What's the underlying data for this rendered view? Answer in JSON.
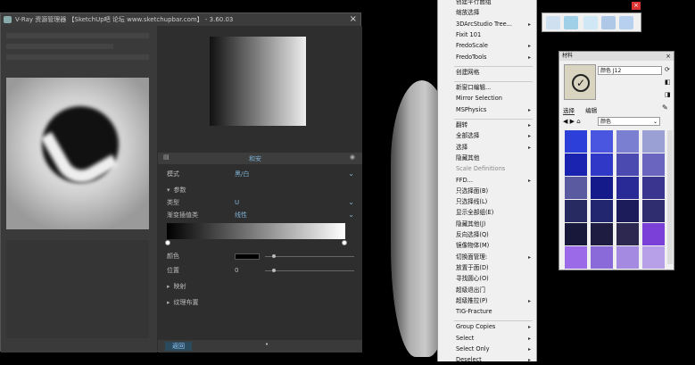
{
  "vray": {
    "title": "V-Ray 资源管理器 【SketchUp吧 论坛 www.sketchupbar.com】 - 3.60.03",
    "close": "×",
    "texture_header": "和安",
    "rows": {
      "mode_label": "模式",
      "mode_value": "黑/白",
      "params_label": "参数",
      "type_label": "类型",
      "type_value": "U",
      "interp_label": "渐变插值类",
      "interp_value": "线性",
      "color_label": "颜色",
      "pos_label": "位置",
      "pos_value": "0",
      "blend_label": "映射",
      "tex_label": "纹理布置"
    },
    "footer_tab": "返回"
  },
  "menu": {
    "items": [
      {
        "label": "创建平行面组",
        "sub": false
      },
      {
        "label": "缩放选择",
        "sub": false
      },
      {
        "label": "3DArcStudio Tree...",
        "sub": true
      },
      {
        "label": "Fixit 101",
        "sub": false
      },
      {
        "label": "FredoScale",
        "sub": true
      },
      {
        "label": "FredoTools",
        "sub": true
      },
      {
        "label": "创建网格",
        "sub": false
      },
      {
        "label": "新窗口编辑...",
        "sub": false
      },
      {
        "label": "Mirror Selection",
        "sub": false
      },
      {
        "label": "MSPhysics",
        "sub": true
      },
      {
        "label": "翻转",
        "sub": true
      },
      {
        "label": "全部选择",
        "sub": true
      },
      {
        "label": "选择",
        "sub": true
      },
      {
        "label": "隐藏其他",
        "sub": false
      },
      {
        "label": "Scale Definitions",
        "sub": false,
        "disabled": true
      },
      {
        "label": "FFD...",
        "sub": true
      },
      {
        "label": "只选择面(B)",
        "sub": false
      },
      {
        "label": "只选择线(L)",
        "sub": false
      },
      {
        "label": "显示全部组(E)",
        "sub": false
      },
      {
        "label": "隐藏其他(J)",
        "sub": false
      },
      {
        "label": "反向选择(Q)",
        "sub": false
      },
      {
        "label": "镜像物体(M)",
        "sub": false
      },
      {
        "label": "切换面管理:",
        "sub": true
      },
      {
        "label": "放置于面(D)",
        "sub": false
      },
      {
        "label": "寻找圆心(O)",
        "sub": false
      },
      {
        "label": "超级退出门",
        "sub": false
      },
      {
        "label": "超级推拉(P)",
        "sub": true
      },
      {
        "label": "TIG-Fracture",
        "sub": false
      },
      {
        "label": "Group Copies",
        "sub": true
      },
      {
        "label": "Select",
        "sub": true
      },
      {
        "label": "Select Only",
        "sub": true
      },
      {
        "label": "Deselect",
        "sub": true
      }
    ],
    "sub_arrow": "▸"
  },
  "toolbar": {
    "close": "×"
  },
  "material": {
    "title": "材料",
    "close": "×",
    "name": "颜色 J12",
    "tab_select": "选择",
    "tab_edit": "编辑",
    "category": "颜色",
    "swatches": [
      "#2c3fd8",
      "#4a56e0",
      "#7a7fd2",
      "#9ba0d4",
      "#1a22b0",
      "#3038c8",
      "#4a4ab0",
      "#6a66c0",
      "#5a5aa0",
      "#141a8a",
      "#2a2a96",
      "#3a3690",
      "#262a60",
      "#22266e",
      "#1c1c5a",
      "#302c70",
      "#18183a",
      "#1e1c40",
      "#2c2850",
      "#7a40d8",
      "#9a6ae8",
      "#8a6ad8",
      "#a48ae0",
      "#b8a0e8"
    ]
  }
}
